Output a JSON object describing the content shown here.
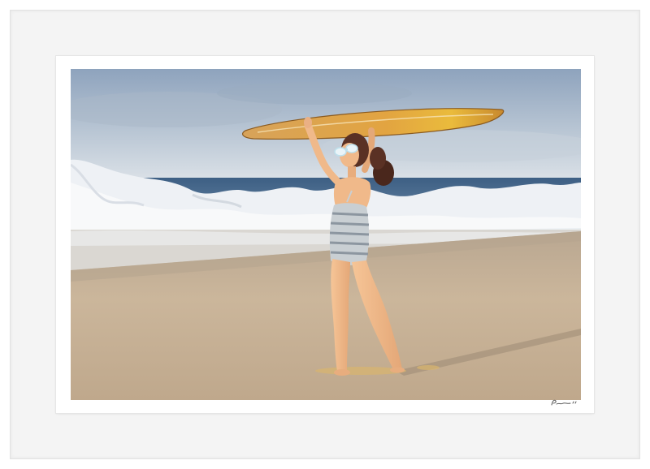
{
  "artwork": {
    "subject": "",
    "signature": "Pr— '21"
  },
  "colors": {
    "frame": "#ffffff",
    "mat": "#ffffff",
    "sky_top": "#8ea3bd",
    "sky_bottom": "#dce2e8",
    "sea": "#4d6f92",
    "surf": "#f3f5f8",
    "sand": "#c7b39a",
    "surfboard": "#e0a64a",
    "swimsuit": "#c9cfd3",
    "skin": "#f0b98a",
    "hair": "#5a3124"
  }
}
